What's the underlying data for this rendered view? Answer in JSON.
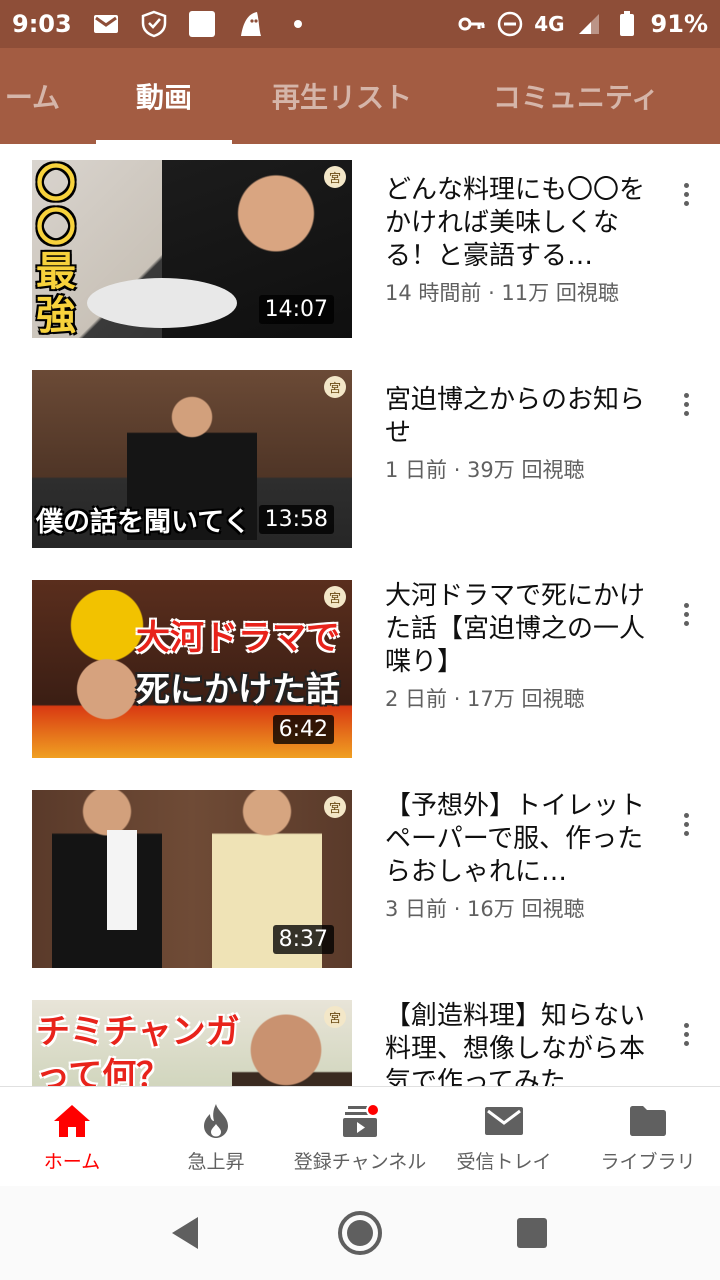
{
  "status_bar": {
    "time": "9:03",
    "battery": "91%",
    "network": "4G",
    "icons": [
      "gmail-icon",
      "shield-check-icon",
      "white-square-icon",
      "ghost-icon",
      "dot-icon",
      "key-icon",
      "do-not-disturb-icon",
      "signal-icon",
      "battery-icon"
    ]
  },
  "tabs": [
    {
      "label": "ーム"
    },
    {
      "label": "動画"
    },
    {
      "label": "再生リスト"
    },
    {
      "label": "コミュニティ"
    }
  ],
  "videos": [
    {
      "title": "どんな料理にも〇〇をかければ美味しくなる！と豪語する…",
      "meta": "14 時間前 · 11万 回視聴",
      "duration": "14:07",
      "thumb_text": "〇〇最強"
    },
    {
      "title": "宮迫博之からのお知らせ",
      "meta": "1 日前 · 39万 回視聴",
      "duration": "13:58",
      "thumb_text": "僕の話を聞いてく"
    },
    {
      "title": "大河ドラマで死にかけた話【宮迫博之の一人喋り】",
      "meta": "2 日前 · 17万 回視聴",
      "duration": "6:42",
      "thumb_text_1": "大河ドラマで",
      "thumb_text_2": "死にかけた話"
    },
    {
      "title": "【予想外】トイレットペーパーで服、作ったらおしゃれに…",
      "meta": "3 日前 · 16万 回視聴",
      "duration": "8:37"
    },
    {
      "title": "【創造料理】知らない料理、想像しながら本気で作ってみた",
      "meta": "",
      "duration": "",
      "thumb_text_1": "チミチャンガ",
      "thumb_text_2": "って何？"
    }
  ],
  "thumb_badge": "宮",
  "bottom_nav": [
    {
      "label": "ホーム",
      "icon": "home-icon"
    },
    {
      "label": "急上昇",
      "icon": "flame-icon"
    },
    {
      "label": "登録チャンネル",
      "icon": "subscriptions-icon"
    },
    {
      "label": "受信トレイ",
      "icon": "inbox-icon"
    },
    {
      "label": "ライブラリ",
      "icon": "library-folder-icon"
    }
  ],
  "colors": {
    "header": "#a35c42",
    "status_bar": "#8e4e38",
    "accent": "#ff0000"
  }
}
